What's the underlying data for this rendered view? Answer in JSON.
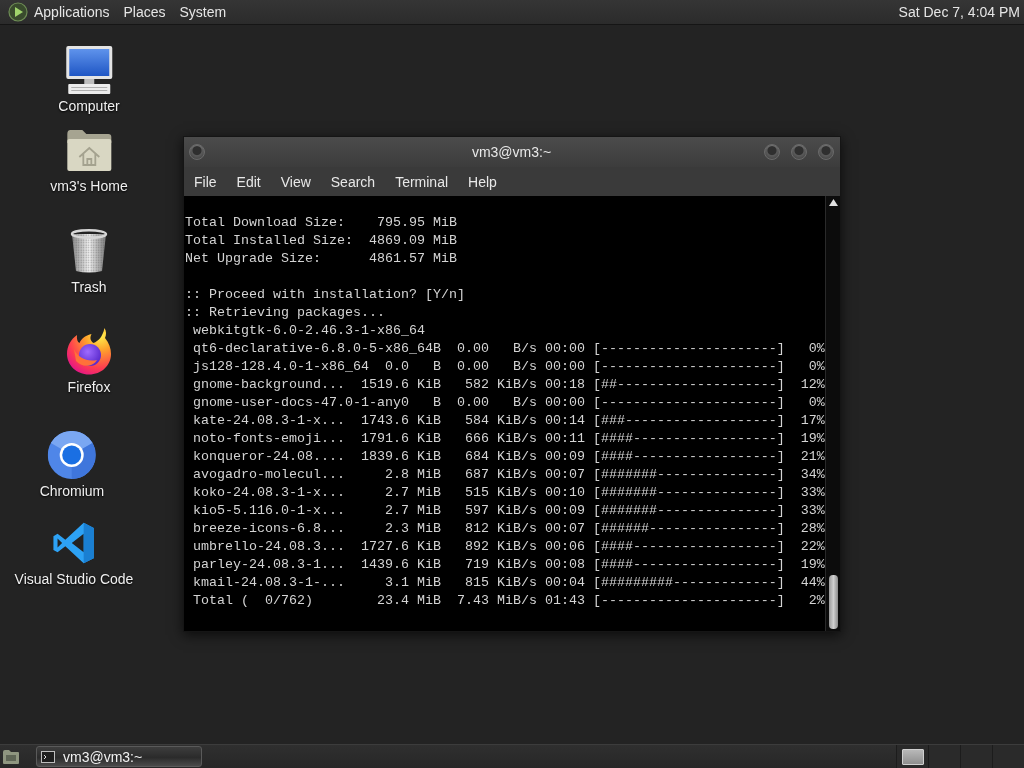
{
  "top_panel": {
    "menus": [
      "Applications",
      "Places",
      "System"
    ],
    "clock": "Sat Dec 7, 4:04 PM"
  },
  "desktop_icons": [
    {
      "kind": "computer",
      "label": "Computer"
    },
    {
      "kind": "home",
      "label": "vm3's Home"
    },
    {
      "kind": "trash",
      "label": "Trash"
    },
    {
      "kind": "firefox",
      "label": "Firefox"
    },
    {
      "kind": "chromium",
      "label": "Chromium"
    },
    {
      "kind": "vscode",
      "label": "Visual Studio Code"
    }
  ],
  "terminal_window": {
    "title": "vm3@vm3:~",
    "menu": [
      "File",
      "Edit",
      "View",
      "Search",
      "Terminal",
      "Help"
    ],
    "output_blocks": [
      [
        "Total Download Size:    795.95 MiB",
        "Total Installed Size:  4869.09 MiB",
        "Net Upgrade Size:      4861.57 MiB"
      ],
      [
        ":: Proceed with installation? [Y/n]",
        ":: Retrieving packages...",
        " webkitgtk-6.0-2.46.3-1-x86_64",
        " qt6-declarative-6.8.0-5-x86_64B  0.00   B/s 00:00 [----------------------]   0%",
        " js128-128.4.0-1-x86_64  0.0   B  0.00   B/s 00:00 [----------------------]   0%",
        " gnome-background...  1519.6 KiB   582 KiB/s 00:18 [##--------------------]  12%",
        " gnome-user-docs-47.0-1-any0   B  0.00   B/s 00:00 [----------------------]   0%",
        " kate-24.08.3-1-x...  1743.6 KiB   584 KiB/s 00:14 [###-------------------]  17%",
        " noto-fonts-emoji...  1791.6 KiB   666 KiB/s 00:11 [####------------------]  19%",
        " konqueror-24.08....  1839.6 KiB   684 KiB/s 00:09 [####------------------]  21%",
        " avogadro-molecul...     2.8 MiB   687 KiB/s 00:07 [#######---------------]  34%",
        " koko-24.08.3-1-x...     2.7 MiB   515 KiB/s 00:10 [#######---------------]  33%",
        " kio5-5.116.0-1-x...     2.7 MiB   597 KiB/s 00:09 [#######---------------]  33%",
        " breeze-icons-6.8...     2.3 MiB   812 KiB/s 00:07 [######----------------]  28%",
        " umbrello-24.08.3...  1727.6 KiB   892 KiB/s 00:06 [####------------------]  22%",
        " parley-24.08.3-1...  1439.6 KiB   719 KiB/s 00:08 [####------------------]  19%",
        " kmail-24.08.3-1-...     3.1 MiB   815 KiB/s 00:04 [#########-------------]  44%",
        " Total (  0/762)        23.4 MiB  7.43 MiB/s 01:43 [----------------------]   2%"
      ]
    ]
  },
  "bottom_panel": {
    "tasks": [
      {
        "label": "vm3@vm3:~"
      }
    ]
  }
}
